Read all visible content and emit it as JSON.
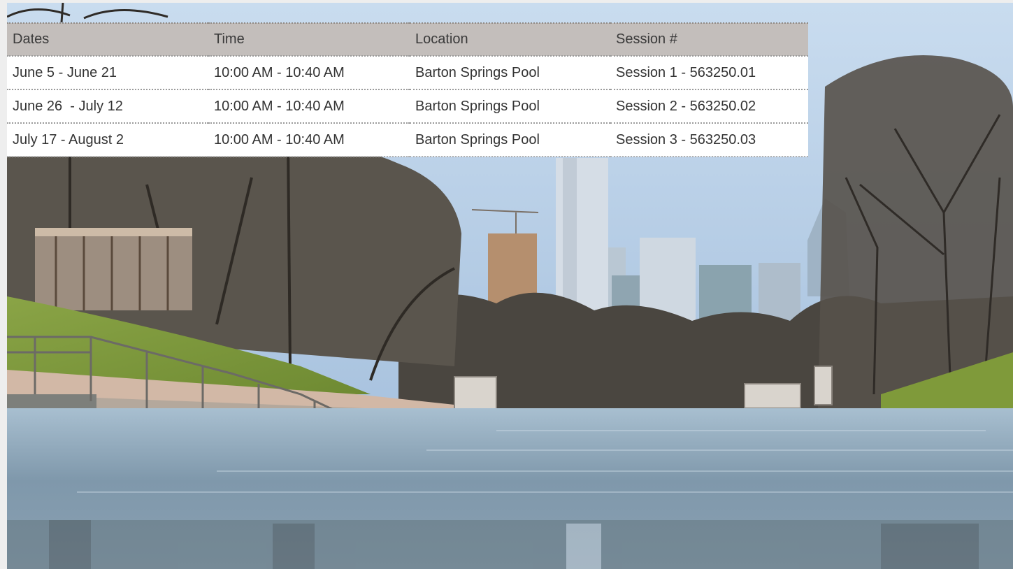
{
  "photo": {
    "subject": "Barton Springs Pool with Austin skyline",
    "sky_color": "#b9d0e8",
    "water_color": "#8ea6b8",
    "grass_color": "#7f9a3a"
  },
  "schedule": {
    "headers": [
      "Dates",
      "Time",
      "Location",
      "Session #"
    ],
    "rows": [
      [
        "June 5 - June 21",
        "10:00 AM - 10:40 AM",
        "Barton Springs Pool",
        "Session 1 - 563250.01"
      ],
      [
        "June 26  - July 12",
        "10:00 AM - 10:40 AM",
        "Barton Springs Pool",
        "Session 2 - 563250.02"
      ],
      [
        "July 17 - August 2",
        "10:00 AM - 10:40 AM",
        "Barton Springs Pool",
        "Session 3 - 563250.03"
      ]
    ],
    "header_bg": "#c3bebb",
    "row_bg": "#ffffff"
  }
}
